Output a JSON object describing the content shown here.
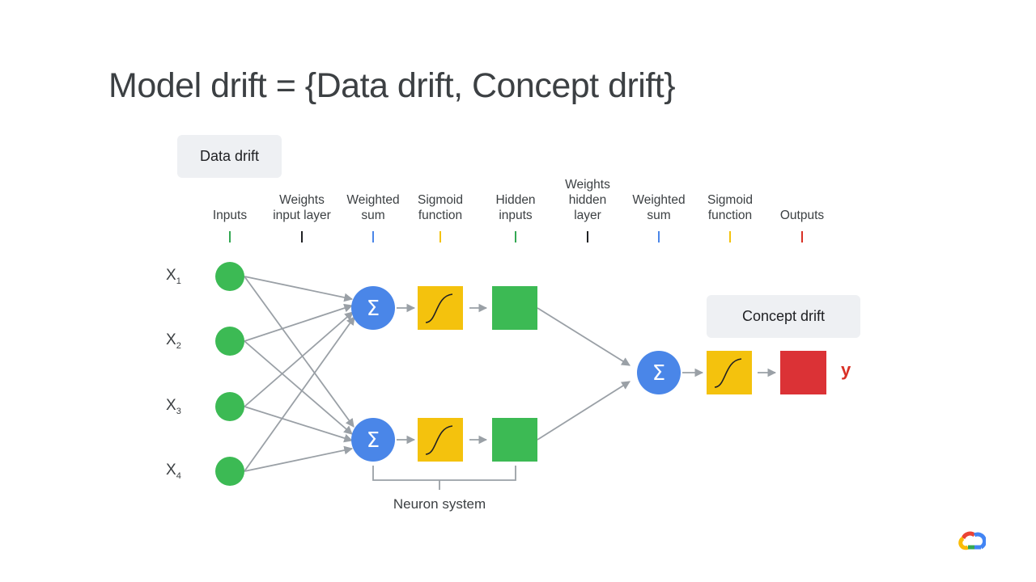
{
  "title": "Model drift = {Data drift, Concept drift}",
  "tags": {
    "data_drift": "Data drift",
    "concept_drift": "Concept drift"
  },
  "columns": [
    {
      "label": "Inputs",
      "color": "#34a853"
    },
    {
      "label": "Weights\ninput layer",
      "color": "#202124"
    },
    {
      "label": "Weighted\nsum",
      "color": "#4a86e8"
    },
    {
      "label": "Sigmoid\nfunction",
      "color": "#f4c20d"
    },
    {
      "label": "Hidden\ninputs",
      "color": "#34a853"
    },
    {
      "label": "Weights\nhidden\nlayer",
      "color": "#202124"
    },
    {
      "label": "Weighted\nsum",
      "color": "#4a86e8"
    },
    {
      "label": "Sigmoid\nfunction",
      "color": "#f4c20d"
    },
    {
      "label": "Outputs",
      "color": "#d93025"
    }
  ],
  "inputs": [
    {
      "base": "X",
      "sub": "1"
    },
    {
      "base": "X",
      "sub": "2"
    },
    {
      "base": "X",
      "sub": "3"
    },
    {
      "base": "X",
      "sub": "4"
    }
  ],
  "sum_symbol": "Σ",
  "neuron_system_label": "Neuron system",
  "output_label": "y",
  "colors": {
    "input_node": "#3cba54",
    "sum_node": "#4a86e8",
    "sigmoid_box": "#f4c20d",
    "hidden_box": "#3cba54",
    "output_box": "#db3236",
    "arrow": "#9aa0a6",
    "tag_bg": "#eef0f3"
  },
  "logo": "google-cloud-logo"
}
